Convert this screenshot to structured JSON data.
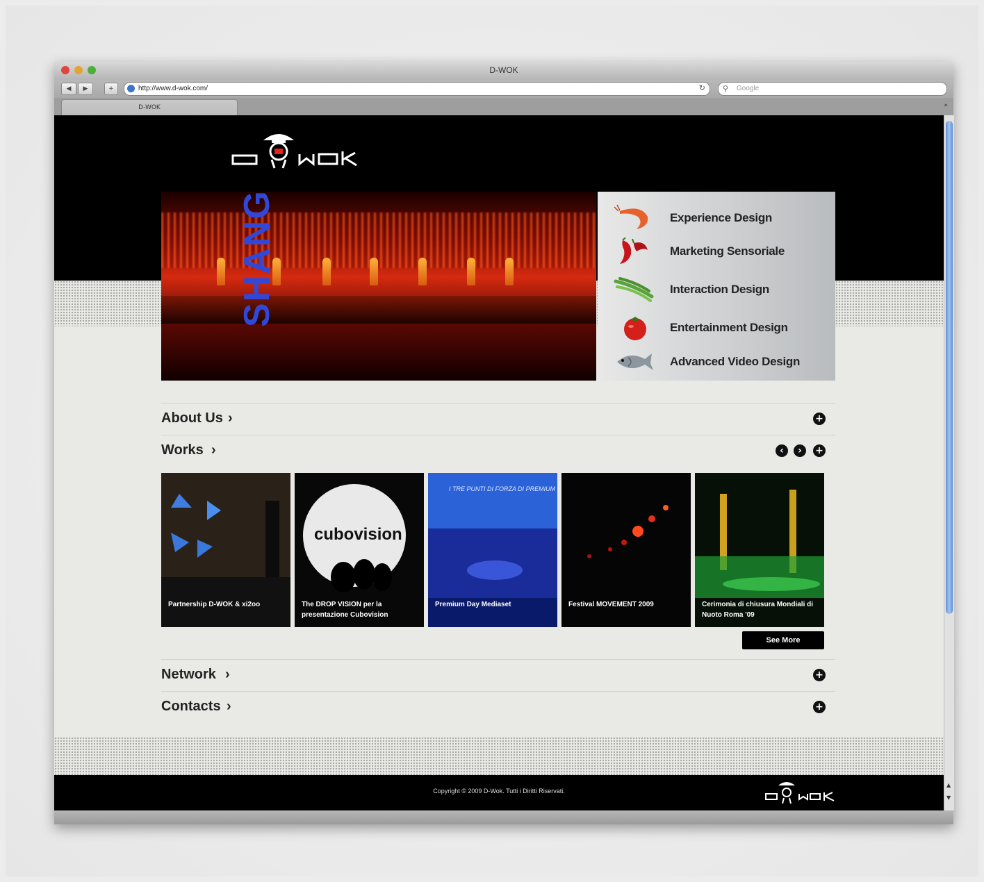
{
  "window": {
    "title": "D-WOK"
  },
  "toolbar": {
    "back_icon": "back-arrow-icon",
    "forward_icon": "forward-arrow-icon",
    "add_icon": "plus-icon",
    "url": "http://www.d-wok.com/",
    "reload_icon": "reload-icon",
    "search_placeholder": "Google"
  },
  "tabs": [
    {
      "label": "D-WOK"
    }
  ],
  "site": {
    "slider_text": "SHANG",
    "slider_dots": [
      {
        "active": false
      },
      {
        "active": false
      },
      {
        "active": false
      },
      {
        "active": false
      },
      {
        "active": true
      }
    ],
    "services": [
      {
        "label": "Experience Design",
        "icon": "shrimp-icon"
      },
      {
        "label": "Marketing Sensoriale",
        "icon": "chili-pepper-icon"
      },
      {
        "label": "Interaction Design",
        "icon": "green-beans-icon"
      },
      {
        "label": "Entertainment Design",
        "icon": "tomato-icon"
      },
      {
        "label": "Advanced Video Design",
        "icon": "fish-icon"
      }
    ],
    "sections": {
      "about": "About Us",
      "works": "Works",
      "network": "Network",
      "contacts": "Contacts"
    },
    "works": [
      {
        "caption": "Partnership D-WOK & xi2oo"
      },
      {
        "caption": "The DROP VISION per la presentazione Cubovision"
      },
      {
        "caption": "Premium Day Mediaset"
      },
      {
        "caption": "Festival MOVEMENT 2009"
      },
      {
        "caption": "Cerimonia di chiusura Mondiali di Nuoto Roma '09"
      }
    ],
    "thumb_texts": {
      "cubo": "cubovision",
      "premium_title": "I TRE PUNTI DI FORZA DI PREMIUM"
    },
    "see_more": "See More",
    "footer": {
      "copyright": "Copyright © 2009 D-Wok. Tutti i Diritti Riservati."
    }
  },
  "colors": {
    "accent_red": "#e8231b",
    "page_bg": "#e9e9e5",
    "black": "#000000"
  }
}
